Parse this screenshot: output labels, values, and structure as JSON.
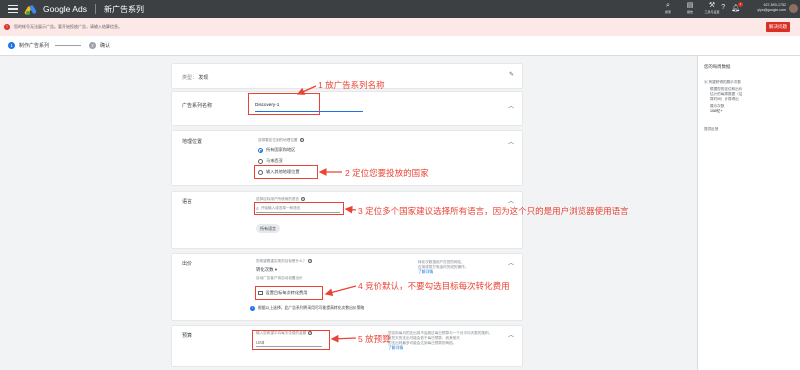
{
  "topbar": {
    "brand": "Google Ads",
    "title": "新广告系列",
    "tools": [
      {
        "icon": "search-icon",
        "label": "搜索"
      },
      {
        "icon": "reports-icon",
        "label": "报告"
      },
      {
        "icon": "tools-icon",
        "label": "工具与设置"
      }
    ],
    "notifications_count": "1",
    "account_id": "627-593-1752",
    "account_email": "ylyo@google.com"
  },
  "alert": {
    "text": "您的帐号无法展示广告。要开始投放广告，请输入结算信息。",
    "button": "解决问题"
  },
  "stepper": {
    "steps": [
      {
        "num": "1",
        "label": "制作广告系列"
      },
      {
        "num": "2",
        "label": "确认"
      }
    ]
  },
  "cards": {
    "type": {
      "label": "类型：",
      "value": "发现"
    },
    "name": {
      "label": "广告系列名称",
      "value": "Discovery-1"
    },
    "location": {
      "label": "地理位置",
      "question": "选择要定位到的地理位置",
      "options": [
        "所有国家和地区",
        "马来西亚",
        "输入其他地理位置"
      ]
    },
    "language": {
      "label": "语言",
      "question": "选择目标用户所使用的语言",
      "placeholder": "开始输入或选择一种语言",
      "chip": "所有语言"
    },
    "bidding": {
      "label": "出价",
      "question": "您希望着重实现的目标是什么？",
      "strategy": "转化次数",
      "sub": "自动广告客户将自动设置出价",
      "checkbox": "设置目标每次转化费用",
      "note": "根据以上选择，此广告系列将采用尽可能提高转化次数出价策略",
      "help1": "转化次数指用户在您的网站、",
      "help2": "应用或拨打电话时完成的操作。",
      "help_link": "了解详情"
    },
    "budget": {
      "label": "预算",
      "question": "输入您希望平均每天花费的金额",
      "value": "US$",
      "help1": "您实际每月的支出将不会超过每日预算与一个月平均天数的乘积。",
      "help2": "某些天的支出可能会低于每日预算，而其他天",
      "help3": "的支出则最多可能会达到每日预算的两倍。",
      "help_link": "了解详情"
    }
  },
  "annotations": {
    "a1": "1 放广告系列名称",
    "a2": "2 定位您要投放的国家",
    "a3": "3 定位多个国家建议选择所有语言，因为这个只的是用户浏览器使用语言",
    "a4": "4 竞价默认，不要勾选目标每次转化费用",
    "a5": "5 放预算"
  },
  "right_panel": {
    "title": "您的每周数据",
    "lines": [
      "根据您的定位和出价",
      "估计的每周数据（估",
      "算时间）计算得出",
      "展示次数",
      "10Ø亿+"
    ],
    "sub": "有望获得的展示次数",
    "link": "提供反馈"
  },
  "colors": {
    "annotation": "#ea4335",
    "accent": "#1a73e8",
    "alert": "#d93025"
  }
}
